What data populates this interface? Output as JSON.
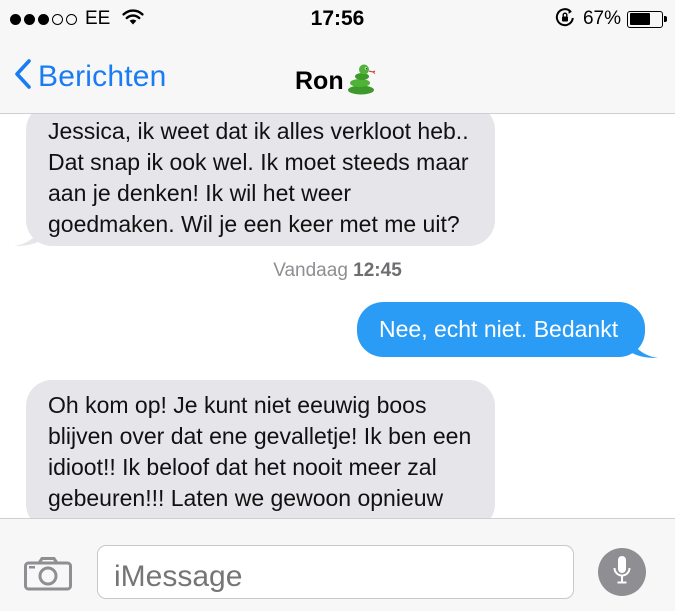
{
  "status_bar": {
    "carrier": "EE",
    "time": "17:56",
    "battery_percent": "67%",
    "battery_level": 0.67,
    "signal_bars_filled": 3,
    "signal_bars_total": 5
  },
  "nav": {
    "back_label": "Berichten",
    "contact_name": "Ron",
    "contact_emoji": "snake-icon"
  },
  "conversation": {
    "messages": [
      {
        "direction": "incoming",
        "text": "Jessica, ik weet dat ik alles verkloot heb..\nDat snap ik ook wel. Ik moet steeds maar\naan je denken! Ik wil het weer\ngoedmaken. Wil je een keer met me uit?"
      },
      {
        "direction": "outgoing",
        "text": "Nee, echt niet. Bedankt"
      },
      {
        "direction": "incoming",
        "text": "Oh kom op! Je kunt niet eeuwig boos\nblijven over dat ene gevalletje! Ik ben een\nidioot!! Ik beloof dat het nooit meer zal\ngebeuren!!! Laten we gewoon opnieuw"
      }
    ],
    "timestamp_day": "Vandaag",
    "timestamp_time": "12:45"
  },
  "input": {
    "placeholder": "iMessage"
  },
  "colors": {
    "accent": "#1a7cf2",
    "outgoing_bubble": "#2a9cf5",
    "incoming_bubble": "#e5e5ea"
  }
}
